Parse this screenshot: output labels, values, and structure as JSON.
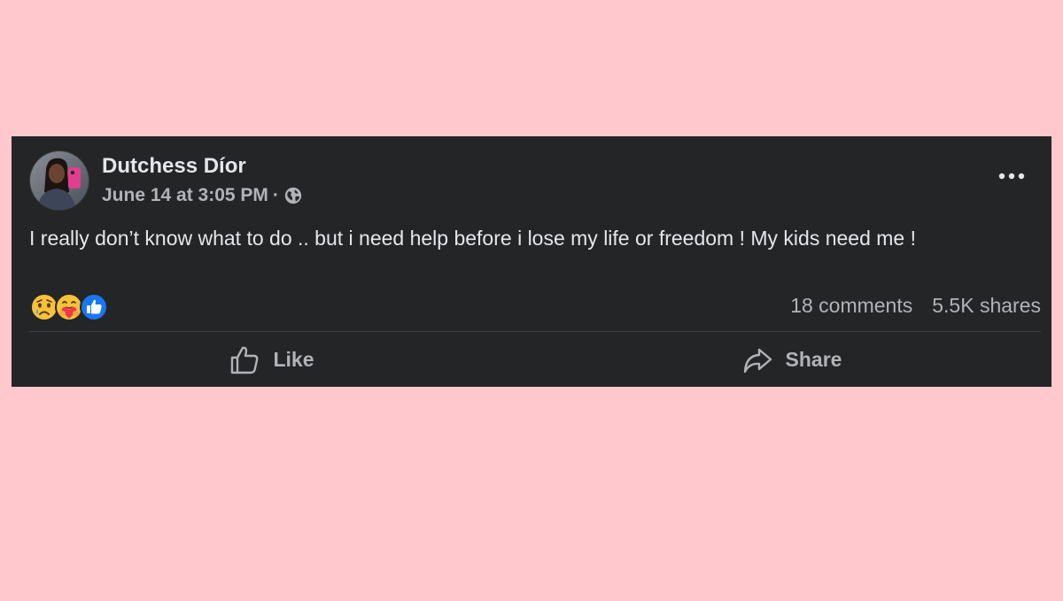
{
  "post": {
    "author": "Dutchess Díor",
    "date": "June 14 at 3:05 PM",
    "separator": "·",
    "privacy_icon": "globe-icon",
    "more_icon": "ellipsis-icon",
    "text": "I really don’t know what to do .. but i need help before i lose my life or freedom ! My kids need me !",
    "reactions": [
      "sad-reaction-icon",
      "care-reaction-icon",
      "like-reaction-icon"
    ],
    "comments": "18 comments",
    "shares": "5.5K shares"
  },
  "actions": {
    "like_label": "Like",
    "share_label": "Share"
  },
  "colors": {
    "page_background": "#ffc8cc",
    "card_background": "#242526",
    "primary_text": "#e4e6eb",
    "secondary_text": "#b0b3b8",
    "like_blue": "#1877f2"
  }
}
